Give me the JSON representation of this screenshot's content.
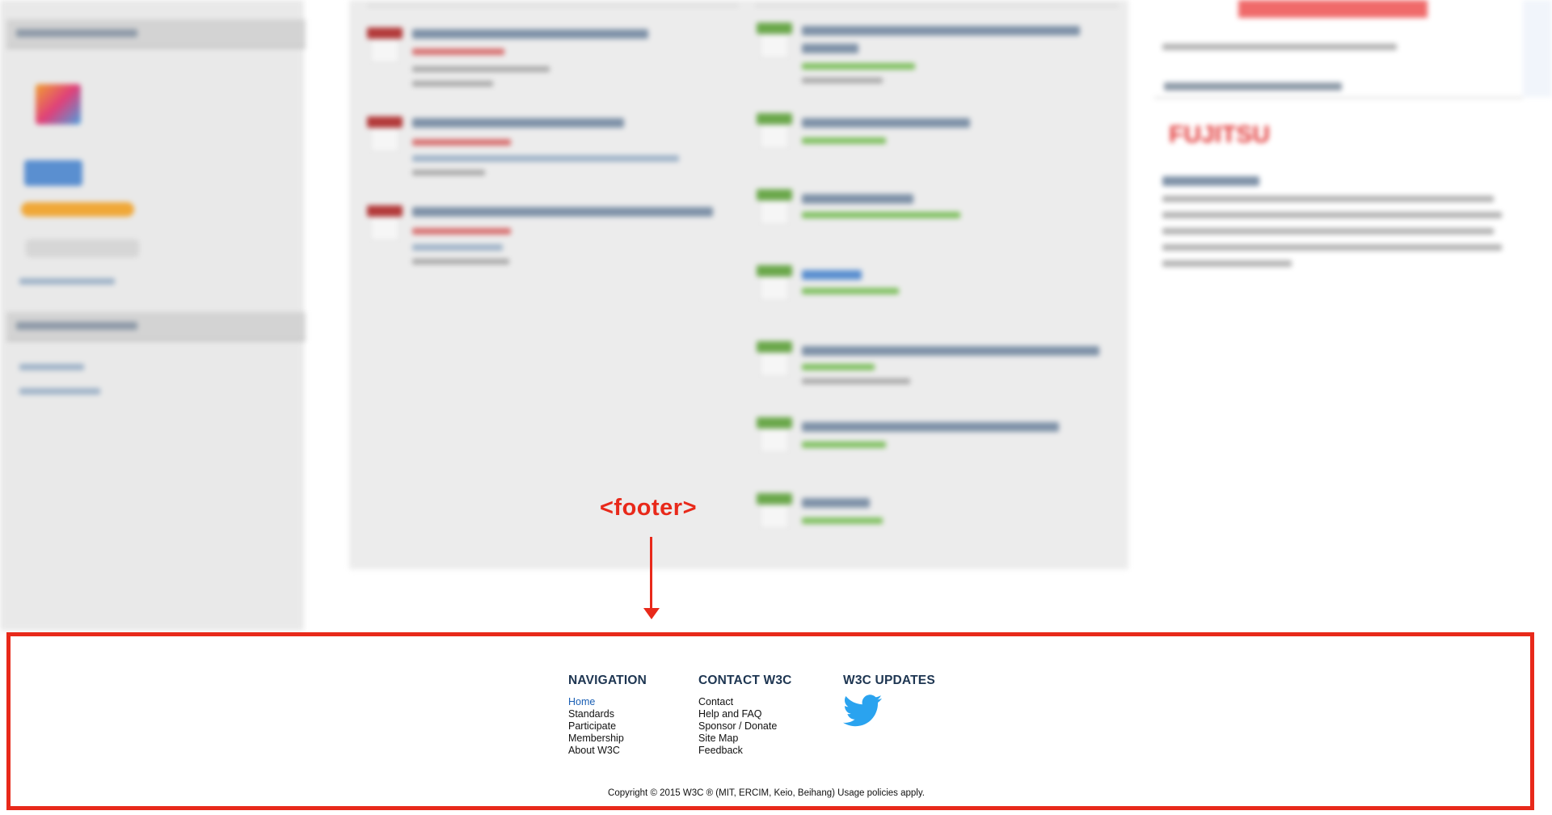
{
  "annotation": {
    "label": "<footer>"
  },
  "footer": {
    "navigation": {
      "heading": "NAVIGATION",
      "links": [
        "Home",
        "Standards",
        "Participate",
        "Membership",
        "About W3C"
      ]
    },
    "contact": {
      "heading": "CONTACT W3C",
      "links": [
        "Contact",
        "Help and FAQ",
        "Sponsor / Donate",
        "Site Map",
        "Feedback"
      ]
    },
    "updates": {
      "heading": "W3C UPDATES",
      "icon": "twitter-icon"
    },
    "copyright": "Copyright © 2015 W3C ® (MIT, ERCIM, Keio, Beihang) Usage policies apply."
  },
  "colors": {
    "annotation": "#e8291a",
    "heading": "#1d3551",
    "active_link": "#1a5fb4",
    "twitter": "#2aa3ef"
  }
}
